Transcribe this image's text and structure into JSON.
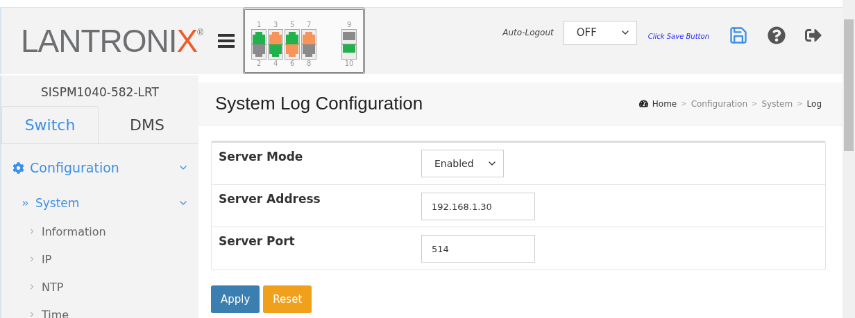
{
  "logo": {
    "text": "LANTRONI",
    "accent": "X",
    "mark": "®"
  },
  "port_rows": [
    [
      {
        "label": "1",
        "color": "#22b24c",
        "kind": "rj45"
      },
      {
        "label": "3",
        "color": "#f7945a",
        "kind": "rj45"
      },
      {
        "label": "5",
        "color": "#22b24c",
        "kind": "rj45"
      },
      {
        "label": "7",
        "color": "#f7945a",
        "kind": "rj45"
      },
      {
        "label": "9",
        "color": "#8a8a8a",
        "kind": "sfp"
      }
    ],
    [
      {
        "label": "2",
        "color": "#8a8a8a",
        "kind": "rj45"
      },
      {
        "label": "4",
        "color": "#22b24c",
        "kind": "rj45"
      },
      {
        "label": "6",
        "color": "#f7945a",
        "kind": "rj45"
      },
      {
        "label": "8",
        "color": "#8a8a8a",
        "kind": "rj45"
      },
      {
        "label": "10",
        "color": "#22b24c",
        "kind": "sfp"
      }
    ]
  ],
  "auto_logout": {
    "label": "Auto-Logout",
    "value": "OFF"
  },
  "save_hint": "Click Save Button",
  "device_name": "SISPM1040-582-LRT",
  "tabs": [
    {
      "label": "Switch",
      "selected": true
    },
    {
      "label": "DMS",
      "selected": false
    }
  ],
  "menu": [
    {
      "label": "Configuration",
      "expanded": true,
      "children": [
        {
          "label": "System",
          "expanded": true,
          "children": [
            {
              "label": "Information"
            },
            {
              "label": "IP"
            },
            {
              "label": "NTP"
            },
            {
              "label": "Time"
            }
          ]
        }
      ]
    }
  ],
  "page_title": "System Log Configuration",
  "breadcrumb": [
    "Home",
    "Configuration",
    "System",
    "Log"
  ],
  "breadcrumb_separator": ">",
  "form": [
    {
      "label": "Server Mode",
      "kind": "select",
      "value": "Enabled"
    },
    {
      "label": "Server Address",
      "kind": "input",
      "value": "192.168.1.30"
    },
    {
      "label": "Server Port",
      "kind": "input",
      "value": "514"
    }
  ],
  "buttons": [
    {
      "label": "Apply",
      "kind": "primary"
    },
    {
      "label": "Reset",
      "kind": "warning"
    }
  ]
}
